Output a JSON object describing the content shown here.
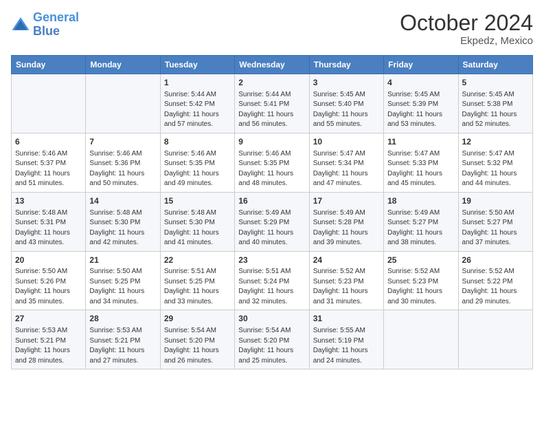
{
  "header": {
    "logo_line1": "General",
    "logo_line2": "Blue",
    "month": "October 2024",
    "location": "Ekpedz, Mexico"
  },
  "weekdays": [
    "Sunday",
    "Monday",
    "Tuesday",
    "Wednesday",
    "Thursday",
    "Friday",
    "Saturday"
  ],
  "weeks": [
    [
      {
        "day": "",
        "info": ""
      },
      {
        "day": "",
        "info": ""
      },
      {
        "day": "1",
        "info": "Sunrise: 5:44 AM\nSunset: 5:42 PM\nDaylight: 11 hours and 57 minutes."
      },
      {
        "day": "2",
        "info": "Sunrise: 5:44 AM\nSunset: 5:41 PM\nDaylight: 11 hours and 56 minutes."
      },
      {
        "day": "3",
        "info": "Sunrise: 5:45 AM\nSunset: 5:40 PM\nDaylight: 11 hours and 55 minutes."
      },
      {
        "day": "4",
        "info": "Sunrise: 5:45 AM\nSunset: 5:39 PM\nDaylight: 11 hours and 53 minutes."
      },
      {
        "day": "5",
        "info": "Sunrise: 5:45 AM\nSunset: 5:38 PM\nDaylight: 11 hours and 52 minutes."
      }
    ],
    [
      {
        "day": "6",
        "info": "Sunrise: 5:46 AM\nSunset: 5:37 PM\nDaylight: 11 hours and 51 minutes."
      },
      {
        "day": "7",
        "info": "Sunrise: 5:46 AM\nSunset: 5:36 PM\nDaylight: 11 hours and 50 minutes."
      },
      {
        "day": "8",
        "info": "Sunrise: 5:46 AM\nSunset: 5:35 PM\nDaylight: 11 hours and 49 minutes."
      },
      {
        "day": "9",
        "info": "Sunrise: 5:46 AM\nSunset: 5:35 PM\nDaylight: 11 hours and 48 minutes."
      },
      {
        "day": "10",
        "info": "Sunrise: 5:47 AM\nSunset: 5:34 PM\nDaylight: 11 hours and 47 minutes."
      },
      {
        "day": "11",
        "info": "Sunrise: 5:47 AM\nSunset: 5:33 PM\nDaylight: 11 hours and 45 minutes."
      },
      {
        "day": "12",
        "info": "Sunrise: 5:47 AM\nSunset: 5:32 PM\nDaylight: 11 hours and 44 minutes."
      }
    ],
    [
      {
        "day": "13",
        "info": "Sunrise: 5:48 AM\nSunset: 5:31 PM\nDaylight: 11 hours and 43 minutes."
      },
      {
        "day": "14",
        "info": "Sunrise: 5:48 AM\nSunset: 5:30 PM\nDaylight: 11 hours and 42 minutes."
      },
      {
        "day": "15",
        "info": "Sunrise: 5:48 AM\nSunset: 5:30 PM\nDaylight: 11 hours and 41 minutes."
      },
      {
        "day": "16",
        "info": "Sunrise: 5:49 AM\nSunset: 5:29 PM\nDaylight: 11 hours and 40 minutes."
      },
      {
        "day": "17",
        "info": "Sunrise: 5:49 AM\nSunset: 5:28 PM\nDaylight: 11 hours and 39 minutes."
      },
      {
        "day": "18",
        "info": "Sunrise: 5:49 AM\nSunset: 5:27 PM\nDaylight: 11 hours and 38 minutes."
      },
      {
        "day": "19",
        "info": "Sunrise: 5:50 AM\nSunset: 5:27 PM\nDaylight: 11 hours and 37 minutes."
      }
    ],
    [
      {
        "day": "20",
        "info": "Sunrise: 5:50 AM\nSunset: 5:26 PM\nDaylight: 11 hours and 35 minutes."
      },
      {
        "day": "21",
        "info": "Sunrise: 5:50 AM\nSunset: 5:25 PM\nDaylight: 11 hours and 34 minutes."
      },
      {
        "day": "22",
        "info": "Sunrise: 5:51 AM\nSunset: 5:25 PM\nDaylight: 11 hours and 33 minutes."
      },
      {
        "day": "23",
        "info": "Sunrise: 5:51 AM\nSunset: 5:24 PM\nDaylight: 11 hours and 32 minutes."
      },
      {
        "day": "24",
        "info": "Sunrise: 5:52 AM\nSunset: 5:23 PM\nDaylight: 11 hours and 31 minutes."
      },
      {
        "day": "25",
        "info": "Sunrise: 5:52 AM\nSunset: 5:23 PM\nDaylight: 11 hours and 30 minutes."
      },
      {
        "day": "26",
        "info": "Sunrise: 5:52 AM\nSunset: 5:22 PM\nDaylight: 11 hours and 29 minutes."
      }
    ],
    [
      {
        "day": "27",
        "info": "Sunrise: 5:53 AM\nSunset: 5:21 PM\nDaylight: 11 hours and 28 minutes."
      },
      {
        "day": "28",
        "info": "Sunrise: 5:53 AM\nSunset: 5:21 PM\nDaylight: 11 hours and 27 minutes."
      },
      {
        "day": "29",
        "info": "Sunrise: 5:54 AM\nSunset: 5:20 PM\nDaylight: 11 hours and 26 minutes."
      },
      {
        "day": "30",
        "info": "Sunrise: 5:54 AM\nSunset: 5:20 PM\nDaylight: 11 hours and 25 minutes."
      },
      {
        "day": "31",
        "info": "Sunrise: 5:55 AM\nSunset: 5:19 PM\nDaylight: 11 hours and 24 minutes."
      },
      {
        "day": "",
        "info": ""
      },
      {
        "day": "",
        "info": ""
      }
    ]
  ]
}
